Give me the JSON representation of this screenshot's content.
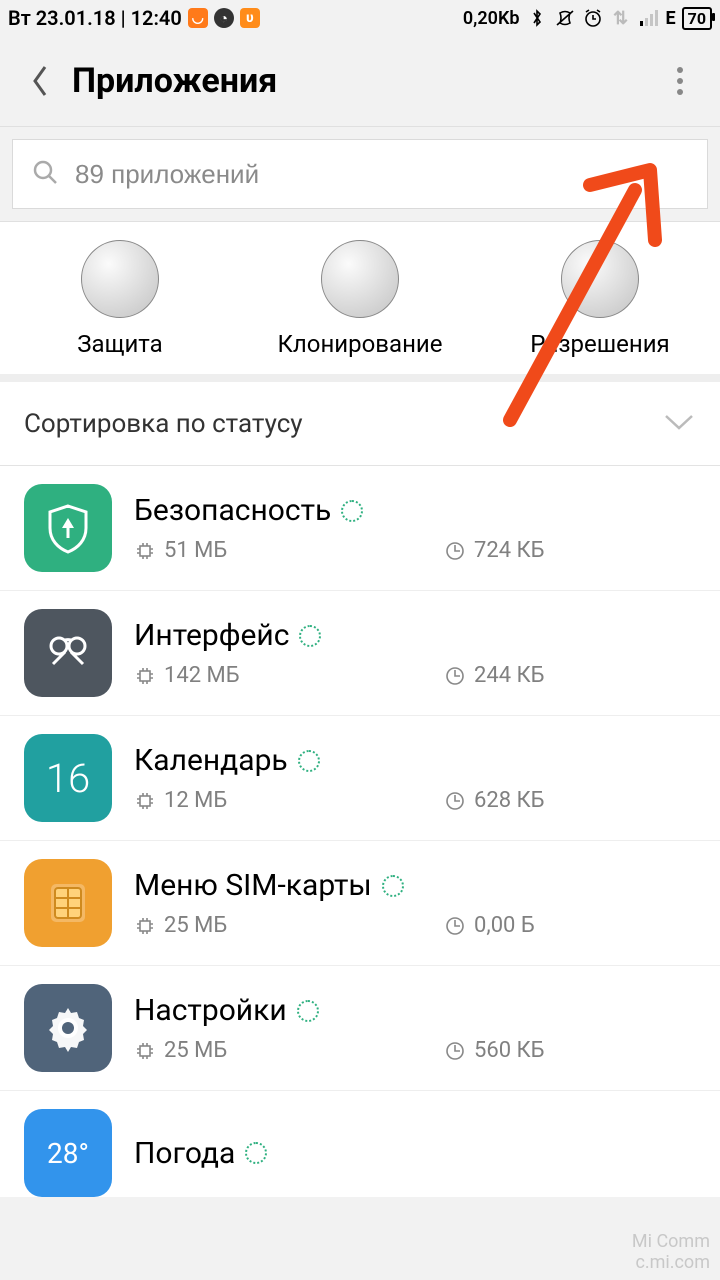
{
  "status": {
    "date_time": "Вт 23.01.18 | 12:40",
    "data": "0,20Kb",
    "net_letter": "E",
    "battery": "70"
  },
  "header": {
    "title": "Приложения"
  },
  "search": {
    "placeholder": "89 приложений"
  },
  "categories": [
    {
      "label": "Защита"
    },
    {
      "label": "Клонирование"
    },
    {
      "label": "Разрешения"
    }
  ],
  "sort": {
    "label": "Сортировка по статусу"
  },
  "apps": [
    {
      "name": "Безопасность",
      "storage": "51 МБ",
      "data": "724 КБ",
      "icon": "security"
    },
    {
      "name": "Интерфейс",
      "storage": "142 МБ",
      "data": "244 КБ",
      "icon": "interface"
    },
    {
      "name": "Календарь",
      "storage": "12 МБ",
      "data": "628 КБ",
      "icon": "calendar",
      "icon_text": "16"
    },
    {
      "name": "Меню SIM-карты",
      "storage": "25 МБ",
      "data": "0,00 Б",
      "icon": "sim"
    },
    {
      "name": "Настройки",
      "storage": "25 МБ",
      "data": "560 КБ",
      "icon": "settings"
    },
    {
      "name": "Погода",
      "storage": "",
      "data": "",
      "icon": "weather",
      "icon_text": "28°"
    }
  ],
  "watermark": {
    "line1": "Mi Comm",
    "line2": "c.mi.com"
  }
}
